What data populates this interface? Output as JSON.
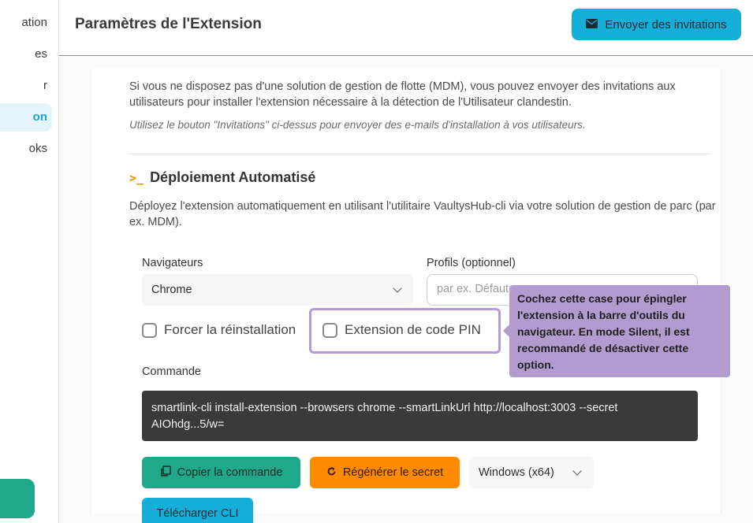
{
  "sidebar": {
    "items": [
      {
        "label": "ation",
        "active": false
      },
      {
        "label": "es",
        "active": false
      },
      {
        "label": "r",
        "active": false
      },
      {
        "label": "on",
        "active": true
      },
      {
        "label": "oks",
        "active": false
      }
    ]
  },
  "header": {
    "title": "Paramètres de l'Extension",
    "invite_button": {
      "label": "Envoyer des invitations",
      "icon": "envelope-icon"
    }
  },
  "content": {
    "intro": "Si vous ne disposez pas d'une solution de gestion de flotte (MDM), vous pouvez envoyer des invitations aux utilisateurs pour installer l'extension nécessaire à la détection de l'Utilisateur clandestin.",
    "intro_hint": "Utilisez le bouton \"Invitations\" ci-dessus pour envoyer des e-mails d'installation à vos utilisateurs.",
    "section": {
      "icon": "terminal-icon",
      "icon_glyph": ">_",
      "title": "Déploiement Automatisé",
      "description": "Déployez l'extension automatiquement en utilisant l'utilitaire VaultysHub-cli via votre solution de gestion de parc (par ex. MDM)."
    },
    "form": {
      "browsers_label": "Navigateurs",
      "browsers_value": "Chrome",
      "profiles_label": "Profils (optionnel)",
      "profiles_placeholder": "par ex. Défaut",
      "force_reinstall_label": "Forcer la réinstallation",
      "force_reinstall_checked": false,
      "pin_extension_label": "Extension de code PIN",
      "pin_extension_checked": false,
      "command_label": "Commande",
      "command_value": "smartlink-cli install-extension --browsers chrome --smartLinkUrl http://localhost:3003 --secret AIOhdg...5/w="
    },
    "actions": {
      "copy_label": "Copier la commande",
      "regen_label": "Régénérer le secret",
      "os_value": "Windows (x64)",
      "download_label": "Télécharger CLI"
    }
  },
  "tooltip": {
    "text": "Cochez cette case pour épingler l'extension à la barre d'outils du navigateur. En mode Silent, il est recommandé de désactiver cette option."
  },
  "colors": {
    "accent_blue": "#14aed9",
    "accent_green": "#1fa88a",
    "accent_orange": "#ff8c00",
    "tooltip_purple": "#b39bd0"
  }
}
